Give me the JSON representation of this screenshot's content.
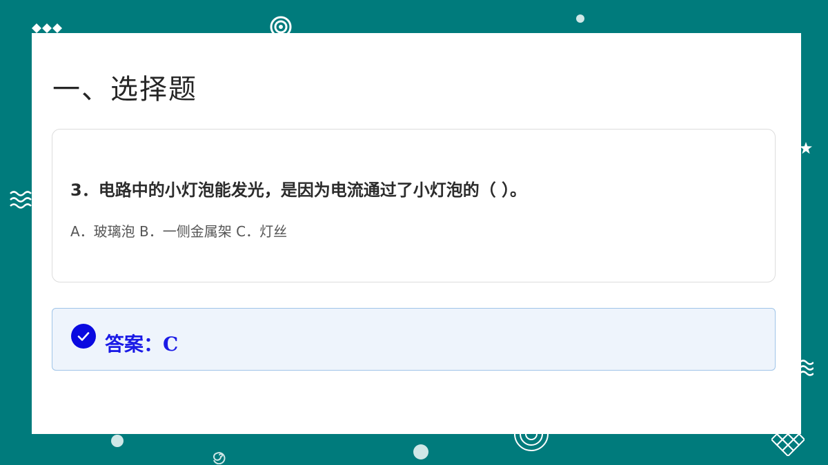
{
  "slide": {
    "title": "一、选择题"
  },
  "question": {
    "text": "3．电路中的小灯泡能发光，是因为电流通过了小灯泡的（ ）。",
    "options": "A．玻璃泡 B．一侧金属架 C．灯丝"
  },
  "answer": {
    "text": "答案：C"
  },
  "colors": {
    "background": "#007b7c",
    "answer_text": "#1a1ae6",
    "answer_bg": "#eef4fc",
    "check_icon": "#0a0ae0"
  }
}
